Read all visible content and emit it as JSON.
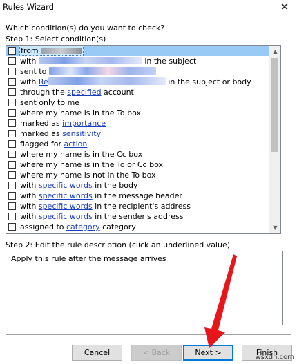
{
  "window": {
    "title": "Rules Wizard",
    "close_glyph": "✕"
  },
  "question": "Which condition(s) do you want to check?",
  "step1_label": "Step 1: Select condition(s)",
  "conditions": [
    {
      "pre": "from ",
      "link": "",
      "post": "",
      "redacted": "gray"
    },
    {
      "pre": "with ",
      "link": "",
      "post": " in the subject",
      "redacted": "blur"
    },
    {
      "pre": "sent to ",
      "link": "",
      "post": "",
      "redacted": "blur"
    },
    {
      "pre": "with ",
      "link": "Re",
      "post": " in the subject or body",
      "redacted": "blur"
    },
    {
      "pre": "through the ",
      "link": "specified",
      "post": " account"
    },
    {
      "pre": "sent only to me",
      "link": "",
      "post": ""
    },
    {
      "pre": "where my name is in the To box",
      "link": "",
      "post": ""
    },
    {
      "pre": "marked as ",
      "link": "importance",
      "post": ""
    },
    {
      "pre": "marked as ",
      "link": "sensitivity",
      "post": ""
    },
    {
      "pre": "flagged for ",
      "link": "action",
      "post": ""
    },
    {
      "pre": "where my name is in the Cc box",
      "link": "",
      "post": ""
    },
    {
      "pre": "where my name is in the To or Cc box",
      "link": "",
      "post": ""
    },
    {
      "pre": "where my name is not in the To box",
      "link": "",
      "post": ""
    },
    {
      "pre": "with ",
      "link": "specific words",
      "post": " in the body"
    },
    {
      "pre": "with ",
      "link": "specific words",
      "post": " in the message header"
    },
    {
      "pre": "with ",
      "link": "specific words",
      "post": " in the recipient's address"
    },
    {
      "pre": "with ",
      "link": "specific words",
      "post": " in the sender's address"
    },
    {
      "pre": "assigned to ",
      "link": "category",
      "post": " category"
    }
  ],
  "step2_label": "Step 2: Edit the rule description (click an underlined value)",
  "description": "Apply this rule after the message arrives",
  "buttons": {
    "cancel": "Cancel",
    "back": "< Back",
    "next": "Next >",
    "finish": "Finish"
  },
  "watermark": "wsxdn.com",
  "colors": {
    "accent": "#0078d7",
    "link": "#1a3dc1",
    "selection": "#99c9f5",
    "annotation_arrow": "#e8151b"
  }
}
